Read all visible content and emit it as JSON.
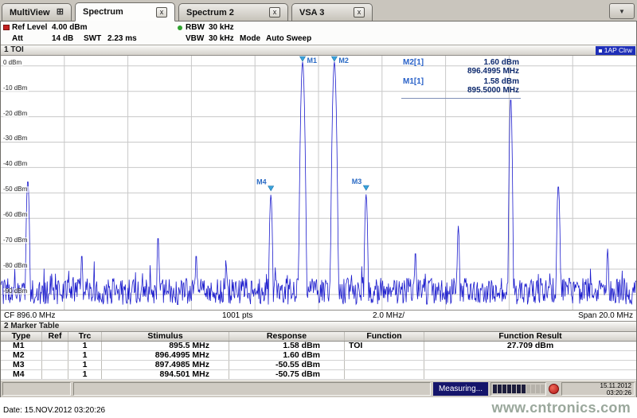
{
  "icons": {
    "close": "x",
    "chevron_down": "▼",
    "multiview_grid": "⊞"
  },
  "tabs": [
    {
      "label": "MultiView"
    },
    {
      "label": "Spectrum"
    },
    {
      "label": "Spectrum 2"
    },
    {
      "label": "VSA 3"
    }
  ],
  "settings": {
    "ref_level_label": "Ref Level",
    "ref_level_value": "4.00 dBm",
    "att_label": "Att",
    "att_value": "14 dB",
    "swt_label": "SWT",
    "swt_value": "2.23 ms",
    "rbw_label": "RBW",
    "rbw_value": "30 kHz",
    "vbw_label": "VBW",
    "vbw_value": "30 kHz",
    "mode_label": "Mode",
    "mode_value": "Auto Sweep"
  },
  "window": {
    "title": "1 TOI",
    "trace_badge": "1AP Clrw"
  },
  "marker_readout": [
    {
      "name": "M2[1]",
      "level": "1.60 dBm",
      "freq": "896.4995 MHz"
    },
    {
      "name": "M1[1]",
      "level": "1.58 dBm",
      "freq": "895.5000 MHz"
    }
  ],
  "axis": {
    "cf": "CF 896.0 MHz",
    "points": "1001 pts",
    "per_div": "2.0 MHz/",
    "span": "Span 20.0 MHz",
    "y_labels": [
      "0 dBm",
      "-10 dBm",
      "-20 dBm",
      "-30 dBm",
      "-40 dBm",
      "-50 dBm",
      "-60 dBm",
      "-70 dBm",
      "-80 dBm",
      "-90 dBm"
    ]
  },
  "marker_table": {
    "title": "2 Marker Table",
    "headers": [
      "Type",
      "Ref",
      "Trc",
      "Stimulus",
      "Response",
      "Function",
      "Function Result"
    ],
    "rows": [
      {
        "type": "M1",
        "ref": "",
        "trc": "1",
        "stimulus": "895.5 MHz",
        "response": "1.58 dBm",
        "function": "TOI",
        "result": "27.709 dBm"
      },
      {
        "type": "M2",
        "ref": "",
        "trc": "1",
        "stimulus": "896.4995 MHz",
        "response": "1.60 dBm",
        "function": "",
        "result": ""
      },
      {
        "type": "M3",
        "ref": "",
        "trc": "1",
        "stimulus": "897.4985 MHz",
        "response": "-50.55 dBm",
        "function": "",
        "result": ""
      },
      {
        "type": "M4",
        "ref": "",
        "trc": "1",
        "stimulus": "894.501 MHz",
        "response": "-50.75 dBm",
        "function": "",
        "result": ""
      }
    ]
  },
  "status_bar": {
    "measuring": "Measuring...",
    "progress_percent": 60,
    "date": "15.11.2012",
    "time": "03:20:26"
  },
  "footer": {
    "date_line": "Date: 15.NOV.2012  03:20:26",
    "watermark": "www.cntronics.com"
  },
  "chart_data": {
    "type": "line",
    "title": "1 TOI",
    "x_unit": "MHz",
    "x_range": [
      886.0,
      906.0
    ],
    "x_center": 896.0,
    "x_span": 20.0,
    "y_unit": "dBm",
    "ref_level_dbm": 4.0,
    "y_top": 4.0,
    "y_bottom": -96.0,
    "db_per_div": 10,
    "grid_y": [
      0,
      -10,
      -20,
      -30,
      -40,
      -50,
      -60,
      -70,
      -80,
      -90
    ],
    "grid_x_divisions": 10,
    "points": 1001,
    "noise_floor_dbm": -88,
    "trace_color": "#1c1ccd",
    "peaks": [
      {
        "freq": 886.85,
        "level": -45.0,
        "width": 0.06
      },
      {
        "freq": 888.55,
        "level": -74.0,
        "width": 0.05
      },
      {
        "freq": 890.95,
        "level": -67.0,
        "width": 0.05
      },
      {
        "freq": 892.15,
        "level": -74.0,
        "width": 0.05
      },
      {
        "freq": 893.1,
        "level": -79.0,
        "width": 0.05
      },
      {
        "freq": 894.501,
        "level": -50.75,
        "width": 0.06
      },
      {
        "freq": 895.5,
        "level": 1.58,
        "width": 0.07
      },
      {
        "freq": 896.4995,
        "level": 1.6,
        "width": 0.07
      },
      {
        "freq": 897.4985,
        "level": -50.55,
        "width": 0.06
      },
      {
        "freq": 899.05,
        "level": -73.0,
        "width": 0.05
      },
      {
        "freq": 900.4,
        "level": -63.0,
        "width": 0.05
      },
      {
        "freq": 902.05,
        "level": -12.5,
        "width": 0.05
      },
      {
        "freq": 903.55,
        "level": -47.0,
        "width": 0.06
      },
      {
        "freq": 905.1,
        "level": -72.0,
        "width": 0.05
      }
    ],
    "markers": [
      {
        "name": "M1",
        "freq": 895.5,
        "level": 1.58
      },
      {
        "name": "M2",
        "freq": 896.4995,
        "level": 1.6
      },
      {
        "name": "M3",
        "freq": 897.4985,
        "level": -50.55
      },
      {
        "name": "M4",
        "freq": 894.501,
        "level": -50.75
      }
    ]
  }
}
